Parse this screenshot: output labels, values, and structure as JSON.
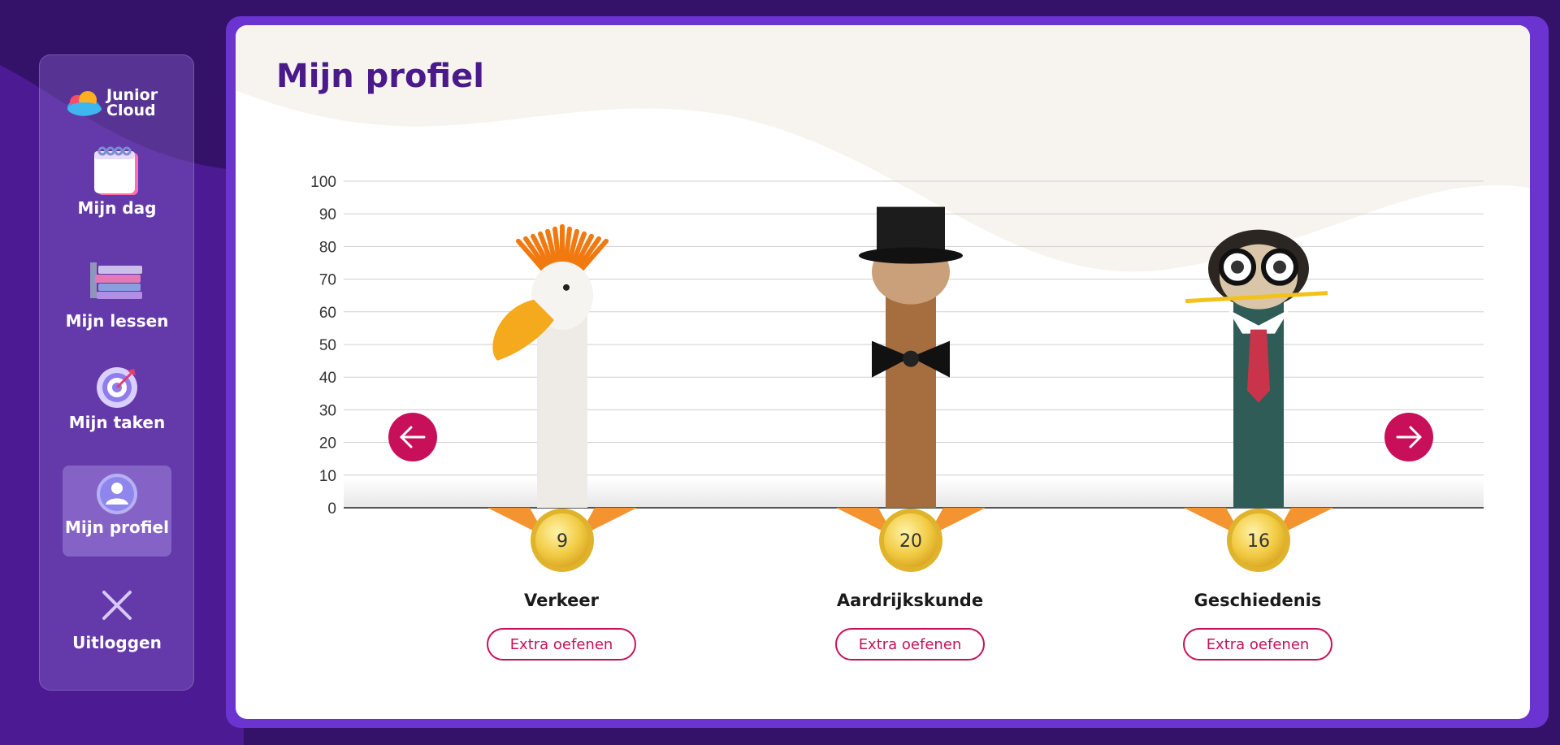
{
  "app": {
    "logo_line1": "Junior",
    "logo_line2": "Cloud"
  },
  "sidebar": {
    "items": [
      {
        "label": "Mijn dag",
        "icon": "calendar-icon"
      },
      {
        "label": "Mijn lessen",
        "icon": "books-icon"
      },
      {
        "label": "Mijn taken",
        "icon": "target-icon"
      },
      {
        "label": "Mijn profiel",
        "icon": "user-icon",
        "active": true
      },
      {
        "label": "Uitloggen",
        "icon": "close-icon"
      }
    ]
  },
  "main": {
    "title": "Mijn profiel",
    "nav": {
      "prev_icon": "arrow-left-icon",
      "next_icon": "arrow-right-icon"
    }
  },
  "chart_data": {
    "type": "bar",
    "categories": [
      "Verkeer",
      "Aardrijkskunde",
      "Geschiedenis"
    ],
    "values": [
      9,
      20,
      16
    ],
    "ylim": [
      0,
      100
    ],
    "yticks": [
      0,
      10,
      20,
      30,
      40,
      50,
      60,
      70,
      80,
      90,
      100
    ],
    "grid": true
  },
  "subjects": [
    {
      "name": "Verkeer",
      "score": 9,
      "button_label": "Extra oefenen",
      "mascot": "goose-mohawk-icon"
    },
    {
      "name": "Aardrijkskunde",
      "score": 20,
      "button_label": "Extra oefenen",
      "mascot": "giraffe-top-hat-icon"
    },
    {
      "name": "Geschiedenis",
      "score": 16,
      "button_label": "Extra oefenen",
      "mascot": "pug-glasses-icon"
    }
  ],
  "colors": {
    "accent": "#c8105a",
    "brand": "#4a1a8a",
    "frame": "#6b34d0"
  }
}
